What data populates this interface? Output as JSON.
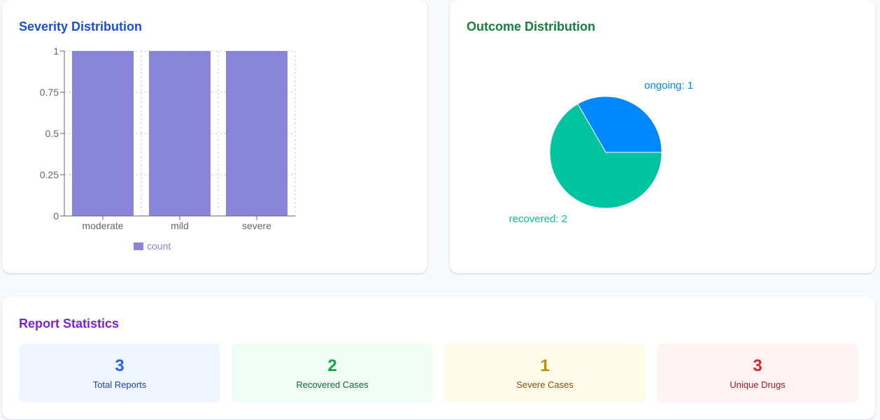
{
  "severity": {
    "title": "Severity Distribution",
    "colors": {
      "bar": "#8884d8",
      "title": "#1d4ed8"
    },
    "chart_data": {
      "type": "bar",
      "categories": [
        "moderate",
        "mild",
        "severe"
      ],
      "series": [
        {
          "name": "count",
          "values": [
            1,
            1,
            1
          ]
        }
      ],
      "ylim": [
        0,
        1
      ],
      "yticks": [
        "0",
        "0.25",
        "0.5",
        "0.75",
        "1"
      ],
      "ytick_values": [
        0,
        0.25,
        0.5,
        0.75,
        1
      ],
      "grid": true,
      "legend": "bottom-center"
    }
  },
  "outcome": {
    "title": "Outcome Distribution",
    "colors": {
      "title": "#15803d"
    },
    "chart_data": {
      "type": "pie",
      "slices": [
        {
          "label": "ongoing",
          "value": 1,
          "color": "#0088fe",
          "text": "ongoing: 1"
        },
        {
          "label": "recovered",
          "value": 2,
          "color": "#00c49f",
          "text": "recovered: 2"
        }
      ]
    }
  },
  "stats": {
    "title": "Report Statistics",
    "items": [
      {
        "value": "3",
        "label": "Total Reports",
        "bg": "#eff6ff",
        "valueColor": "#2563eb",
        "labelColor": "#1e40af"
      },
      {
        "value": "2",
        "label": "Recovered Cases",
        "bg": "#f0fdf4",
        "valueColor": "#16a34a",
        "labelColor": "#166534"
      },
      {
        "value": "1",
        "label": "Severe Cases",
        "bg": "#fefce8",
        "valueColor": "#ca8a04",
        "labelColor": "#854d0e"
      },
      {
        "value": "3",
        "label": "Unique Drugs",
        "bg": "#fef2f2",
        "valueColor": "#dc2626",
        "labelColor": "#991b1b"
      }
    ]
  }
}
